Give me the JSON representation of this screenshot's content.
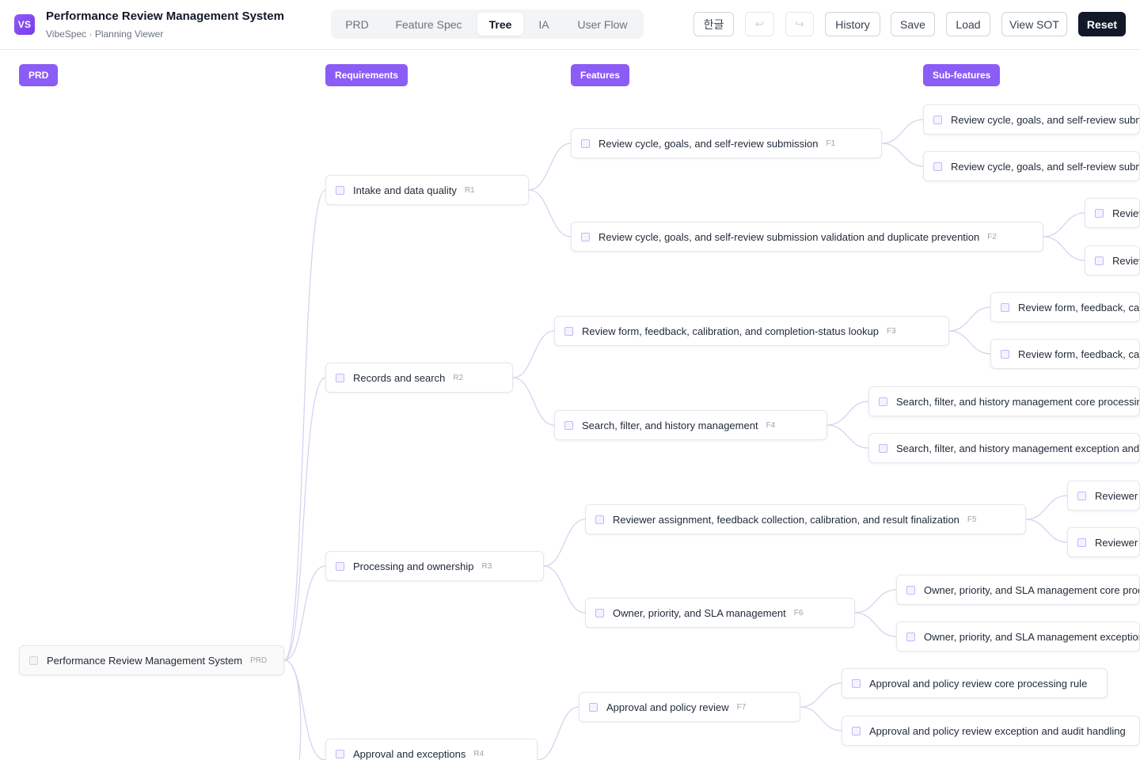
{
  "app": {
    "logo": "VS",
    "title": "Performance Review Management System",
    "subtitle": "VibeSpec · Planning Viewer"
  },
  "tabs": [
    {
      "label": "PRD",
      "active": false
    },
    {
      "label": "Feature Spec",
      "active": false
    },
    {
      "label": "Tree",
      "active": true
    },
    {
      "label": "IA",
      "active": false
    },
    {
      "label": "User Flow",
      "active": false
    }
  ],
  "toolbar": {
    "lang_label": "한글",
    "undo_icon": "undo-icon",
    "redo_icon": "redo-icon",
    "undo_glyph": "↩",
    "redo_glyph": "↪",
    "history_label": "History",
    "save_label": "Save",
    "load_label": "Load",
    "view_sot_label": "View SOT",
    "reset_label": "Reset"
  },
  "columns": {
    "prd": "PRD",
    "requirements": "Requirements",
    "features": "Features",
    "subfeatures": "Sub-features"
  },
  "colors": {
    "accent": "#8b5cf6",
    "link": "#d8d2f0"
  },
  "tree": {
    "root": {
      "label": "Performance Review Management System",
      "code": "PRD"
    },
    "requirements": [
      {
        "label": "Intake and data quality",
        "code": "R1"
      },
      {
        "label": "Records and search",
        "code": "R2"
      },
      {
        "label": "Processing and ownership",
        "code": "R3"
      },
      {
        "label": "Approval and exceptions",
        "code": "R4"
      }
    ],
    "features": [
      {
        "label": "Review cycle, goals, and self-review submission",
        "code": "F1"
      },
      {
        "label": "Review cycle, goals, and self-review submission validation and duplicate prevention",
        "code": "F2"
      },
      {
        "label": "Review form, feedback, calibration, and completion-status lookup",
        "code": "F3"
      },
      {
        "label": "Search, filter, and history management",
        "code": "F4"
      },
      {
        "label": "Reviewer assignment, feedback collection, calibration, and result finalization",
        "code": "F5"
      },
      {
        "label": "Owner, priority, and SLA management",
        "code": "F6"
      },
      {
        "label": "Approval and policy review",
        "code": "F7"
      }
    ],
    "subfeatures": [
      {
        "label": "Review cycle, goals, and self-review submis"
      },
      {
        "label": "Review cycle, goals, and self-review submis"
      },
      {
        "label": "Review"
      },
      {
        "label": "Review"
      },
      {
        "label": "Review form, feedback, cali"
      },
      {
        "label": "Review form, feedback, cali"
      },
      {
        "label": "Search, filter, and history management core processing"
      },
      {
        "label": "Search, filter, and history management exception and a"
      },
      {
        "label": "Reviewer a"
      },
      {
        "label": "Reviewer a"
      },
      {
        "label": "Owner, priority, and SLA management core proc"
      },
      {
        "label": "Owner, priority, and SLA management exception"
      },
      {
        "label": "Approval and policy review core processing rule"
      },
      {
        "label": "Approval and policy review exception and audit handling"
      }
    ]
  }
}
